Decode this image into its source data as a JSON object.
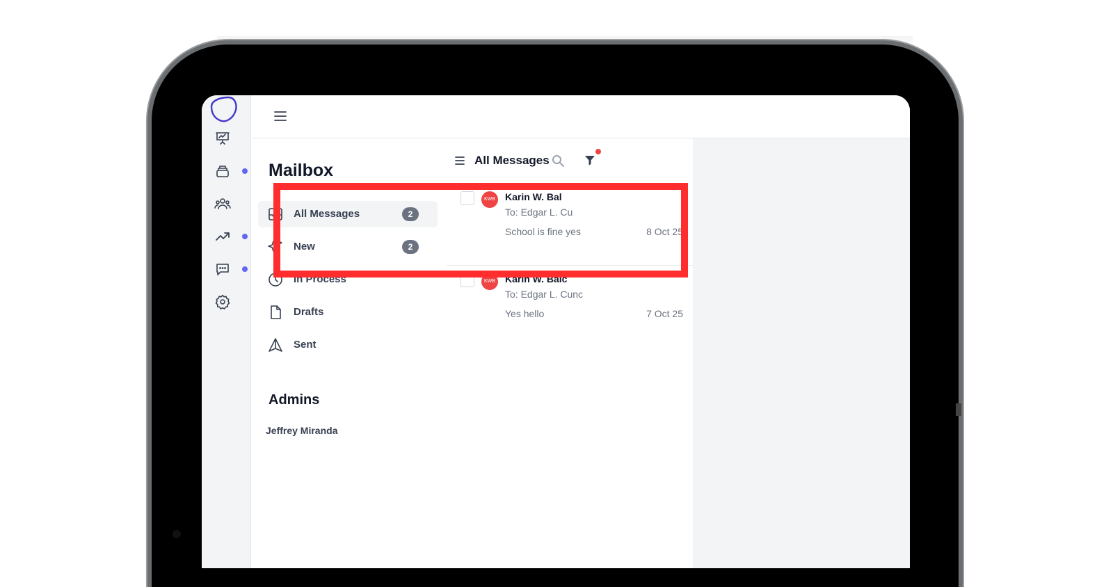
{
  "colors": {
    "accent": "#6366f1",
    "badge": "#6b7280",
    "avatar": "#ef4444",
    "highlight": "#ff2d2d",
    "notification_dot": "#ef4444"
  },
  "rail": {
    "items": [
      {
        "icon": "presentation-chart-icon",
        "has_dot": false
      },
      {
        "icon": "archive-stack-icon",
        "has_dot": true
      },
      {
        "icon": "users-group-icon",
        "has_dot": false
      },
      {
        "icon": "trending-up-icon",
        "has_dot": true
      },
      {
        "icon": "chat-bubble-icon",
        "has_dot": true
      },
      {
        "icon": "gear-icon",
        "has_dot": false
      }
    ]
  },
  "mailbox": {
    "title": "Mailbox",
    "folders": [
      {
        "label": "All Messages",
        "count": "2",
        "icon": "inbox-icon",
        "active": true
      },
      {
        "label": "New",
        "count": "2",
        "icon": "sparkles-icon",
        "active": false
      },
      {
        "label": "In Process",
        "count": "",
        "icon": "clock-icon",
        "active": false
      },
      {
        "label": "Drafts",
        "count": "",
        "icon": "document-icon",
        "active": false
      },
      {
        "label": "Sent",
        "count": "",
        "icon": "send-icon",
        "active": false
      }
    ],
    "admins_title": "Admins",
    "admins": [
      "Jeffrey Miranda"
    ]
  },
  "list": {
    "title": "All Messages",
    "messages": [
      {
        "avatar": "KWB",
        "from": "Karin W. Bal",
        "to": "To: Edgar L. Cu",
        "subject": "School is fine yes",
        "date": "8 Oct 25"
      },
      {
        "avatar": "KWB",
        "from": "Karin W. Balc",
        "to": "To: Edgar L. Cunc",
        "subject": "Yes hello",
        "date": "7 Oct 25"
      }
    ]
  }
}
